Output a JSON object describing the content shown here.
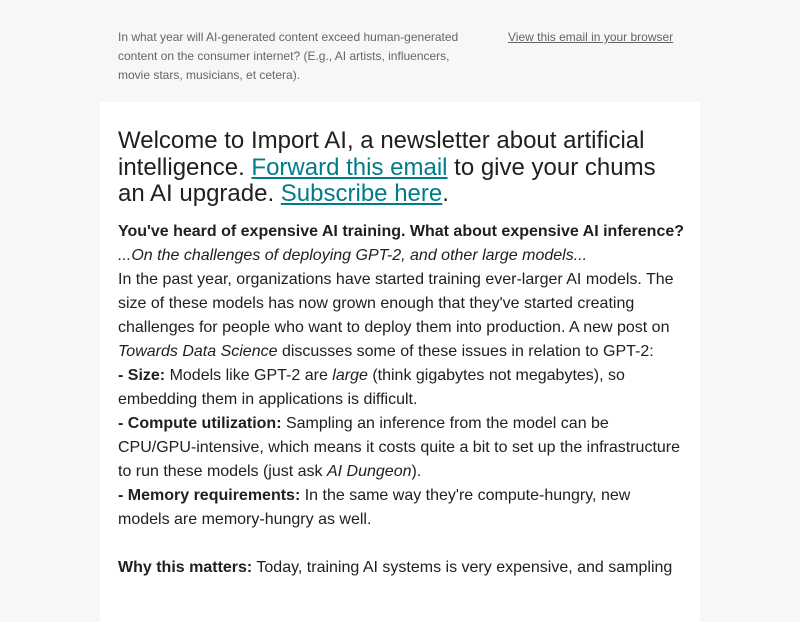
{
  "preheader": {
    "question": "In what year will AI-generated content exceed human-generated content on the consumer internet? (E.g., AI artists, influencers, movie stars, musicians, et cetera).",
    "view_in_browser": "View this email in your browser"
  },
  "intro": {
    "text_1": "Welcome to Import AI, a newsletter about artificial intelligence. ",
    "forward_link": "Forward this email",
    "text_2": " to give your chums an AI upgrade. ",
    "subscribe_link": "Subscribe here",
    "text_3": "."
  },
  "article": {
    "headline": "You've heard of expensive AI training. What about expensive AI inference?",
    "subtitle": "...On the challenges of deploying GPT-2, and other large models...",
    "para_1a": "In the past year, organizations have started training ever-larger AI models. The size of these models has now grown enough that they've started creating challenges for people who want to deploy them into production. A new post on ",
    "para_1_source": "Towards Data Science",
    "para_1b": " discusses some of these issues in relation to GPT-2:",
    "size_label": "- Size:",
    "size_text_a": " Models like GPT-2 are ",
    "size_emphasis": "large",
    "size_text_b": " (think gigabytes not megabytes), so embedding them in applications is difficult.",
    "compute_label": "- Compute utilization:",
    "compute_text_a": " Sampling an inference from the model can be CPU/GPU-intensive, which means it costs quite a bit to set up the infrastructure to run these models (just ask ",
    "compute_emphasis": "AI Dungeon",
    "compute_text_b": ").",
    "memory_label": "- Memory requirements:",
    "memory_text": " In the same way they're compute-hungry, new models are memory-hungry as well.",
    "why_label": "Why this matters:",
    "why_text": " Today, training AI systems is very expensive, and sampling"
  }
}
